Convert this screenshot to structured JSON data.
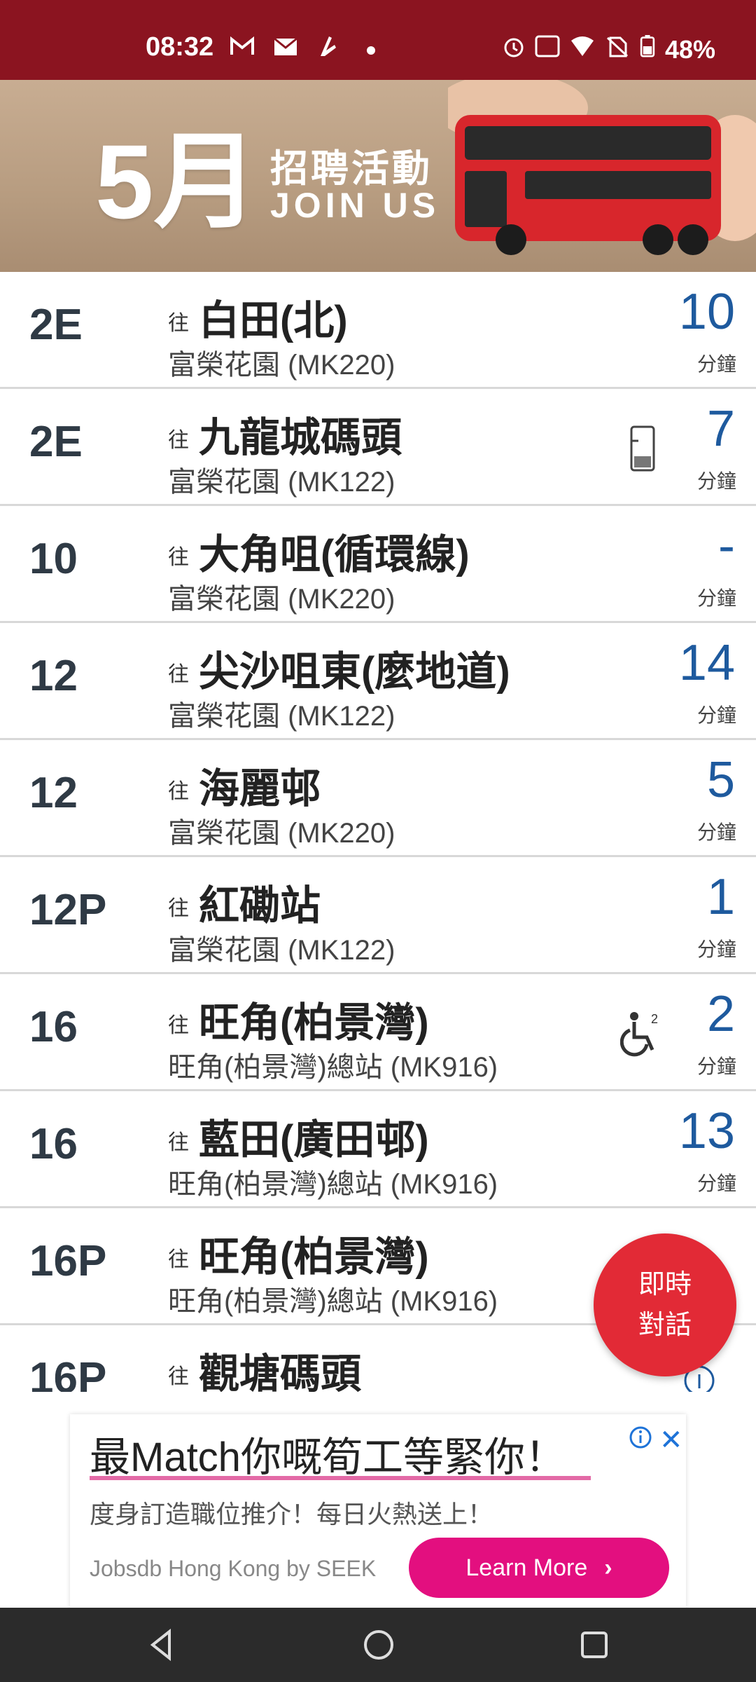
{
  "status": {
    "time": "08:32",
    "battery": "48%",
    "icons": [
      "gmail-icon",
      "mail-icon",
      "app-icon",
      "dot",
      "alarm-icon",
      "auto-icon",
      "wifi-icon",
      "no-sim-icon",
      "battery-icon"
    ]
  },
  "banner": {
    "month": "5月",
    "title": "招聘活動",
    "subtitle": "JOIN US"
  },
  "eta_rows": [
    {
      "route": "2E",
      "to": "往",
      "dest": "白田(北)",
      "stop": "富榮花園 (MK220)",
      "eta": "10",
      "unit": "分鐘"
    },
    {
      "route": "2E",
      "to": "往",
      "dest": "九龍城碼頭",
      "stop": "富榮花園 (MK122)",
      "eta": "7",
      "unit": "分鐘"
    },
    {
      "route": "10",
      "to": "往",
      "dest": "大角咀(循環線)",
      "stop": "富榮花園 (MK220)",
      "eta": "-",
      "unit": "分鐘"
    },
    {
      "route": "12",
      "to": "往",
      "dest": "尖沙咀東(麼地道)",
      "stop": "富榮花園 (MK122)",
      "eta": "14",
      "unit": "分鐘"
    },
    {
      "route": "12",
      "to": "往",
      "dest": "海麗邨",
      "stop": "富榮花園 (MK220)",
      "eta": "5",
      "unit": "分鐘"
    },
    {
      "route": "12P",
      "to": "往",
      "dest": "紅磡站",
      "stop": "富榮花園 (MK122)",
      "eta": "1",
      "unit": "分鐘"
    },
    {
      "route": "16",
      "to": "往",
      "dest": "旺角(柏景灣)",
      "stop": "旺角(柏景灣)總站 (MK916)",
      "eta": "2",
      "unit": "分鐘"
    },
    {
      "route": "16",
      "to": "往",
      "dest": "藍田(廣田邨)",
      "stop": "旺角(柏景灣)總站 (MK916)",
      "eta": "13",
      "unit": "分鐘"
    },
    {
      "route": "16P",
      "to": "往",
      "dest": "旺角(柏景灣)",
      "stop": "旺角(柏景灣)總站 (MK916)",
      "eta": "",
      "unit": ""
    },
    {
      "route": "16P",
      "to": "往",
      "dest": "觀塘碼頭",
      "stop": "",
      "eta": "",
      "unit": ""
    }
  ],
  "chat": {
    "line1": "即時",
    "line2": "對話"
  },
  "ad": {
    "headline": "最Match你嘅筍工等緊你！",
    "subtext": "度身訂造職位推介！每日火熱送上！",
    "brand": "Jobsdb Hong Kong by SEEK",
    "button": "Learn More"
  }
}
